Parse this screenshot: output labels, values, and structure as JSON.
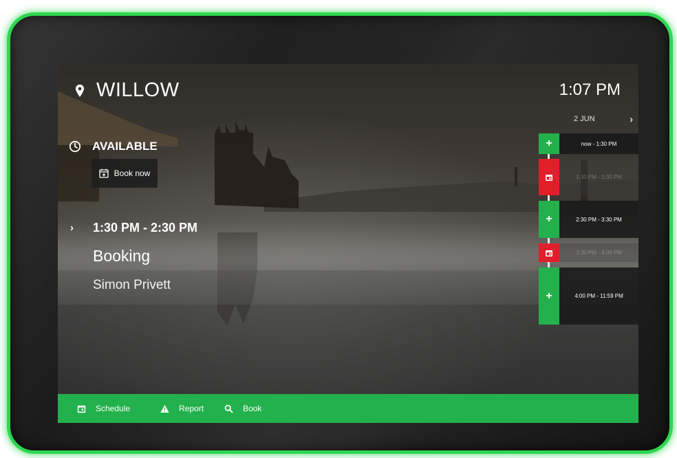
{
  "room": {
    "name": "WILLOW",
    "icon": "map-pin-icon"
  },
  "clock": {
    "time": "1:07 PM"
  },
  "date_nav": {
    "date": "2 JUN",
    "next_symbol": "›"
  },
  "status": {
    "text": "AVAILABLE",
    "icon": "clock-icon"
  },
  "book_now": {
    "label": "Book now",
    "icon": "calendar-plus-icon"
  },
  "next_booking": {
    "arrow": "›",
    "time": "1:30 PM - 2:30 PM",
    "title": "Booking",
    "organizer": "Simon Privett"
  },
  "timeline": {
    "slots": [
      {
        "type": "free",
        "symbol": "+",
        "label": "now - 1:30 PM"
      },
      {
        "type": "busy",
        "symbol": "calendar",
        "label": "1:30 PM - 2:30 PM"
      },
      {
        "type": "free",
        "symbol": "+",
        "label": "2:30 PM - 3:30 PM"
      },
      {
        "type": "busy",
        "symbol": "calendar",
        "label": "3:30 PM - 4:00 PM"
      },
      {
        "type": "free",
        "symbol": "+",
        "label": "4:00 PM - 11:59 PM"
      }
    ]
  },
  "bottom_bar": {
    "items": [
      {
        "label": "Schedule",
        "icon": "calendar-icon"
      },
      {
        "label": "Report",
        "icon": "warning-icon"
      },
      {
        "label": "Book",
        "icon": "search-icon"
      }
    ]
  },
  "colors": {
    "accent_green": "#23b14d",
    "busy_red": "#e01f2b",
    "frame_glow": "#2fd651"
  }
}
